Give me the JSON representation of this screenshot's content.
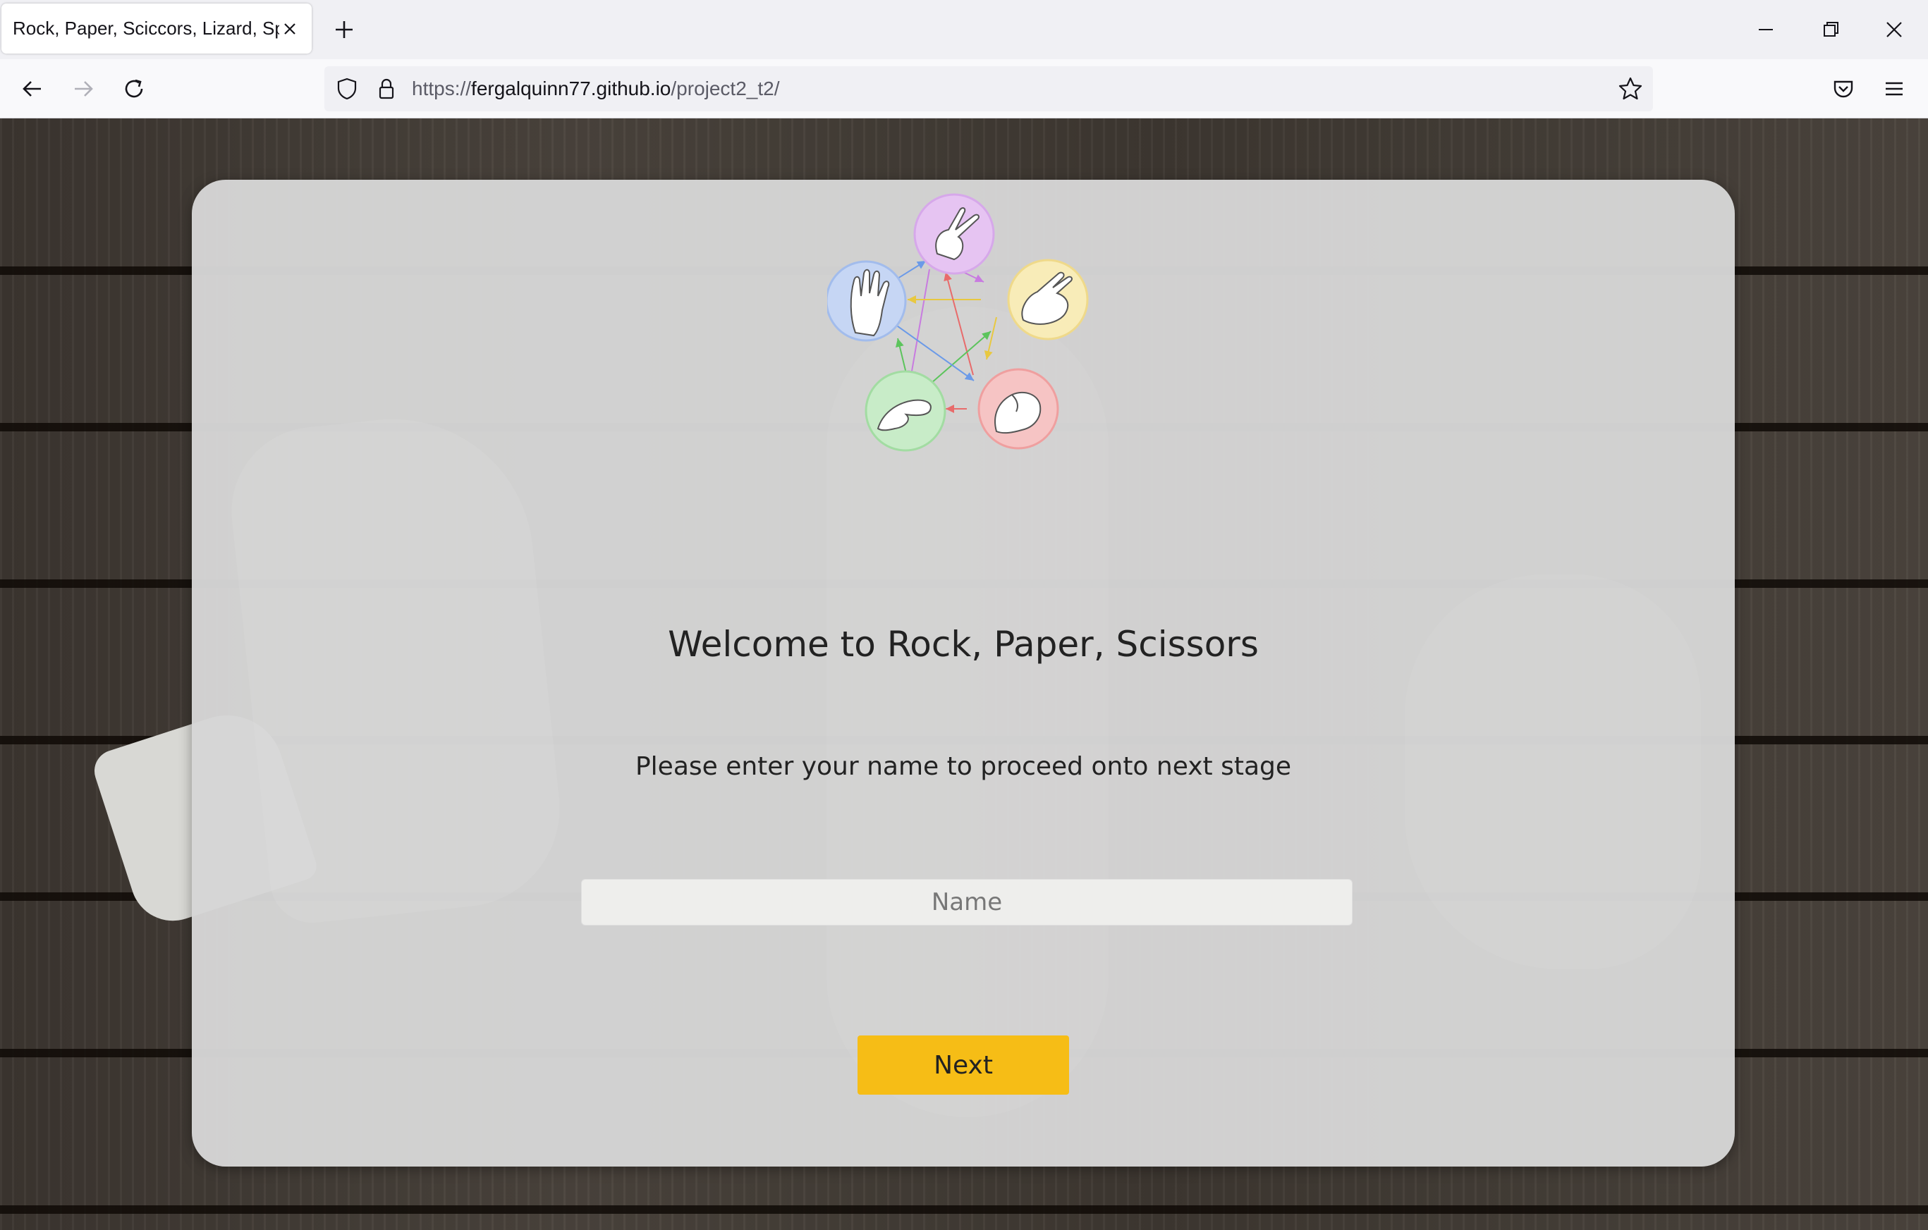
{
  "browser": {
    "tab_title": "Rock, Paper, Sciccors, Lizard, Spock",
    "url_scheme": "https://",
    "url_host": "fergalquinn77.github.io",
    "url_path": "/project2_t2/"
  },
  "page": {
    "welcome_text": "Welcome to Rock, Paper, Scissors",
    "prompt_text": "Please enter your name to proceed onto next stage",
    "name_placeholder": "Name",
    "name_value": "",
    "next_label": "Next"
  },
  "logo": {
    "nodes": [
      {
        "gesture": "scissors",
        "color": "#e6c4f2"
      },
      {
        "gesture": "paper",
        "color": "#f8ecb8"
      },
      {
        "gesture": "rock",
        "color": "#f6c4c4"
      },
      {
        "gesture": "lizard",
        "color": "#c8ecc8"
      },
      {
        "gesture": "spock",
        "color": "#c6d6f4"
      }
    ]
  },
  "colors": {
    "accent": "#f6bd16",
    "card": "#d6d6d6"
  }
}
